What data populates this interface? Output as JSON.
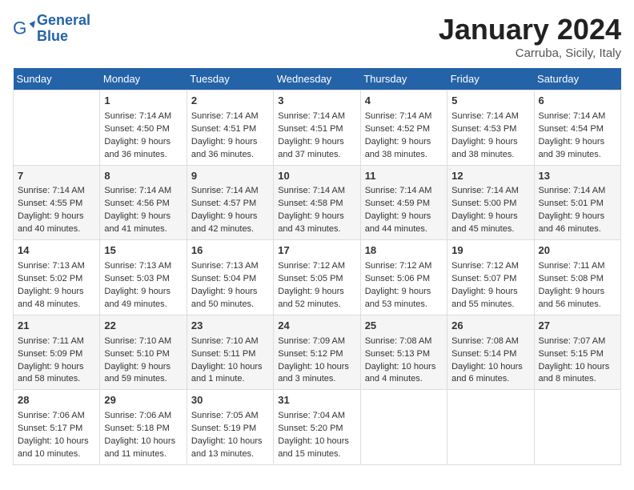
{
  "header": {
    "logo_line1": "General",
    "logo_line2": "Blue",
    "month": "January 2024",
    "location": "Carruba, Sicily, Italy"
  },
  "days_of_week": [
    "Sunday",
    "Monday",
    "Tuesday",
    "Wednesday",
    "Thursday",
    "Friday",
    "Saturday"
  ],
  "weeks": [
    [
      {
        "day": "",
        "content": ""
      },
      {
        "day": "1",
        "content": "Sunrise: 7:14 AM\nSunset: 4:50 PM\nDaylight: 9 hours\nand 36 minutes."
      },
      {
        "day": "2",
        "content": "Sunrise: 7:14 AM\nSunset: 4:51 PM\nDaylight: 9 hours\nand 36 minutes."
      },
      {
        "day": "3",
        "content": "Sunrise: 7:14 AM\nSunset: 4:51 PM\nDaylight: 9 hours\nand 37 minutes."
      },
      {
        "day": "4",
        "content": "Sunrise: 7:14 AM\nSunset: 4:52 PM\nDaylight: 9 hours\nand 38 minutes."
      },
      {
        "day": "5",
        "content": "Sunrise: 7:14 AM\nSunset: 4:53 PM\nDaylight: 9 hours\nand 38 minutes."
      },
      {
        "day": "6",
        "content": "Sunrise: 7:14 AM\nSunset: 4:54 PM\nDaylight: 9 hours\nand 39 minutes."
      }
    ],
    [
      {
        "day": "7",
        "content": "Sunrise: 7:14 AM\nSunset: 4:55 PM\nDaylight: 9 hours\nand 40 minutes."
      },
      {
        "day": "8",
        "content": "Sunrise: 7:14 AM\nSunset: 4:56 PM\nDaylight: 9 hours\nand 41 minutes."
      },
      {
        "day": "9",
        "content": "Sunrise: 7:14 AM\nSunset: 4:57 PM\nDaylight: 9 hours\nand 42 minutes."
      },
      {
        "day": "10",
        "content": "Sunrise: 7:14 AM\nSunset: 4:58 PM\nDaylight: 9 hours\nand 43 minutes."
      },
      {
        "day": "11",
        "content": "Sunrise: 7:14 AM\nSunset: 4:59 PM\nDaylight: 9 hours\nand 44 minutes."
      },
      {
        "day": "12",
        "content": "Sunrise: 7:14 AM\nSunset: 5:00 PM\nDaylight: 9 hours\nand 45 minutes."
      },
      {
        "day": "13",
        "content": "Sunrise: 7:14 AM\nSunset: 5:01 PM\nDaylight: 9 hours\nand 46 minutes."
      }
    ],
    [
      {
        "day": "14",
        "content": "Sunrise: 7:13 AM\nSunset: 5:02 PM\nDaylight: 9 hours\nand 48 minutes."
      },
      {
        "day": "15",
        "content": "Sunrise: 7:13 AM\nSunset: 5:03 PM\nDaylight: 9 hours\nand 49 minutes."
      },
      {
        "day": "16",
        "content": "Sunrise: 7:13 AM\nSunset: 5:04 PM\nDaylight: 9 hours\nand 50 minutes."
      },
      {
        "day": "17",
        "content": "Sunrise: 7:12 AM\nSunset: 5:05 PM\nDaylight: 9 hours\nand 52 minutes."
      },
      {
        "day": "18",
        "content": "Sunrise: 7:12 AM\nSunset: 5:06 PM\nDaylight: 9 hours\nand 53 minutes."
      },
      {
        "day": "19",
        "content": "Sunrise: 7:12 AM\nSunset: 5:07 PM\nDaylight: 9 hours\nand 55 minutes."
      },
      {
        "day": "20",
        "content": "Sunrise: 7:11 AM\nSunset: 5:08 PM\nDaylight: 9 hours\nand 56 minutes."
      }
    ],
    [
      {
        "day": "21",
        "content": "Sunrise: 7:11 AM\nSunset: 5:09 PM\nDaylight: 9 hours\nand 58 minutes."
      },
      {
        "day": "22",
        "content": "Sunrise: 7:10 AM\nSunset: 5:10 PM\nDaylight: 9 hours\nand 59 minutes."
      },
      {
        "day": "23",
        "content": "Sunrise: 7:10 AM\nSunset: 5:11 PM\nDaylight: 10 hours\nand 1 minute."
      },
      {
        "day": "24",
        "content": "Sunrise: 7:09 AM\nSunset: 5:12 PM\nDaylight: 10 hours\nand 3 minutes."
      },
      {
        "day": "25",
        "content": "Sunrise: 7:08 AM\nSunset: 5:13 PM\nDaylight: 10 hours\nand 4 minutes."
      },
      {
        "day": "26",
        "content": "Sunrise: 7:08 AM\nSunset: 5:14 PM\nDaylight: 10 hours\nand 6 minutes."
      },
      {
        "day": "27",
        "content": "Sunrise: 7:07 AM\nSunset: 5:15 PM\nDaylight: 10 hours\nand 8 minutes."
      }
    ],
    [
      {
        "day": "28",
        "content": "Sunrise: 7:06 AM\nSunset: 5:17 PM\nDaylight: 10 hours\nand 10 minutes."
      },
      {
        "day": "29",
        "content": "Sunrise: 7:06 AM\nSunset: 5:18 PM\nDaylight: 10 hours\nand 11 minutes."
      },
      {
        "day": "30",
        "content": "Sunrise: 7:05 AM\nSunset: 5:19 PM\nDaylight: 10 hours\nand 13 minutes."
      },
      {
        "day": "31",
        "content": "Sunrise: 7:04 AM\nSunset: 5:20 PM\nDaylight: 10 hours\nand 15 minutes."
      },
      {
        "day": "",
        "content": ""
      },
      {
        "day": "",
        "content": ""
      },
      {
        "day": "",
        "content": ""
      }
    ]
  ]
}
